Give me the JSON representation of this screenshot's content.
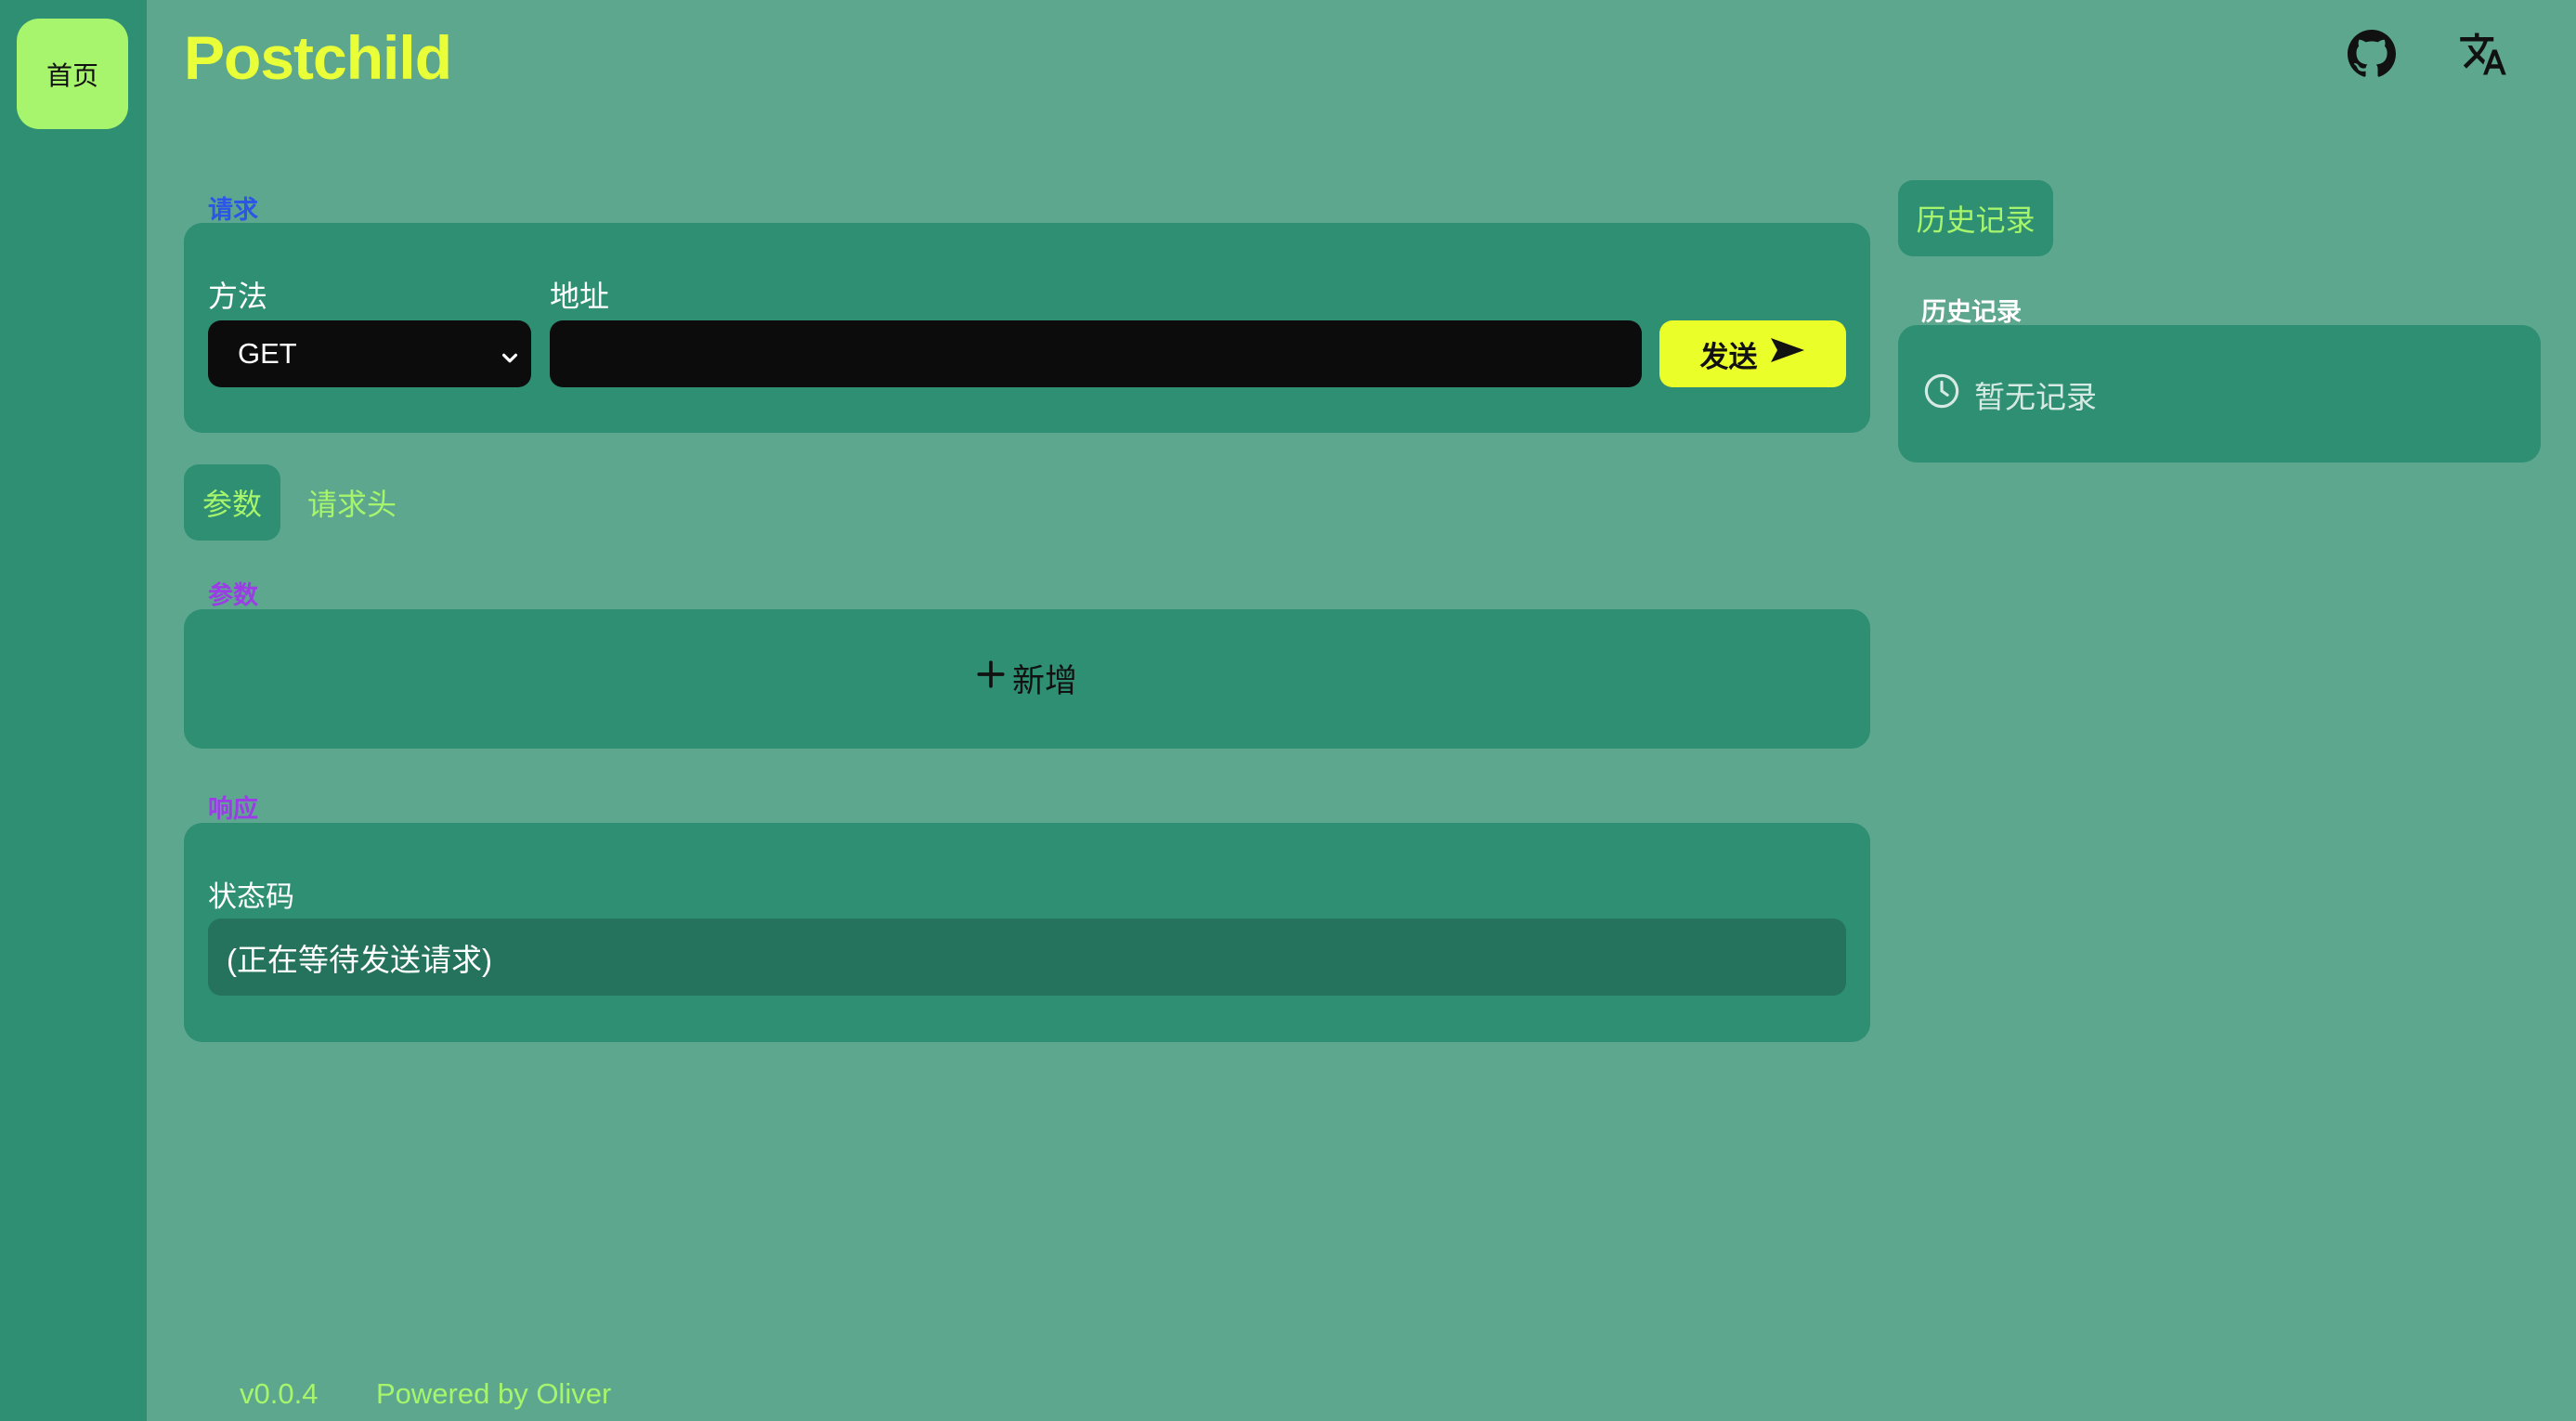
{
  "nav": {
    "home_label": "首页"
  },
  "header": {
    "app_title": "Postchild",
    "github_icon": "github-icon",
    "translate_icon": "translate-icon"
  },
  "request": {
    "section_label": "请求",
    "method_label": "方法",
    "method_value": "GET",
    "url_label": "地址",
    "url_value": "",
    "send_label": "发送"
  },
  "tabs": [
    {
      "label": "参数",
      "active": true
    },
    {
      "label": "请求头",
      "active": false
    }
  ],
  "params": {
    "section_label": "参数",
    "add_label": "新增"
  },
  "response": {
    "section_label": "响应",
    "status_label": "状态码",
    "status_value": "(正在等待发送请求)"
  },
  "history": {
    "button_label": "历史记录",
    "section_label": "历史记录",
    "empty_text": "暂无记录"
  },
  "footer": {
    "version": "v0.0.4",
    "powered_by": "Powered by Oliver"
  },
  "colors": {
    "background": "#5da78f",
    "panel": "#2e8f73",
    "accent_green": "#a6f56c",
    "accent_yellow": "#eaff2a",
    "label_blue": "#2d55e6",
    "label_purple": "#9b3ce6"
  }
}
